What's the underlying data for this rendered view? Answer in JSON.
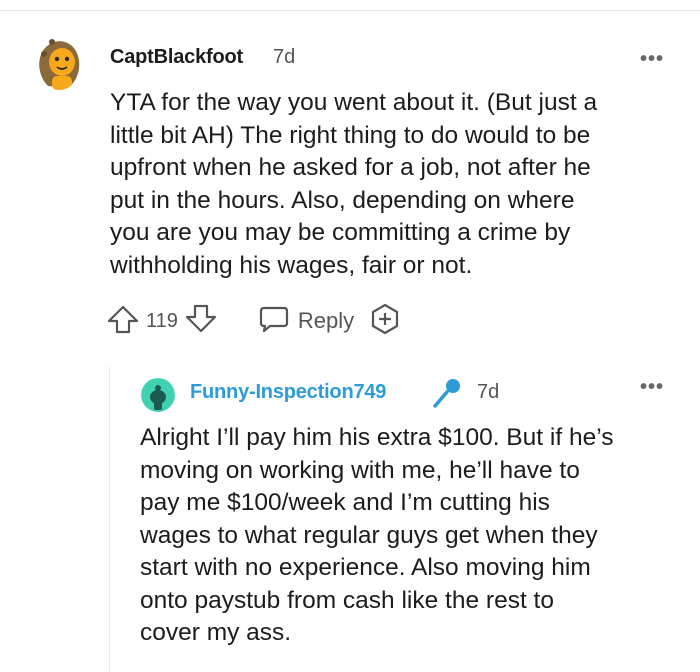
{
  "comment": {
    "author": "CaptBlackfoot",
    "age": "7d",
    "more_label": "•••",
    "body_lines": [
      "YTA for the way you went about it. (But just a",
      "little bit AH) The right thing to do would to be",
      "upfront when he asked for a job, not after he",
      "put in the hours. Also, depending on where",
      "you are you may be committing a crime by",
      "withholding his wages, fair or not."
    ],
    "vote_count": "119",
    "reply_label": "Reply"
  },
  "reply": {
    "author": "Funny-Inspection749",
    "age": "7d",
    "more_label": "•••",
    "body_lines": [
      "Alright I’ll pay him his extra $100. But if he’s",
      "moving on working with me, he’ll have to",
      "pay me $100/week and I’m cutting his",
      "wages to what regular guys get when they",
      "start with no experience. Also moving him",
      "onto paystub from cash like the rest to",
      "cover my ass."
    ]
  },
  "icons": {
    "upvote": "upvote-arrow-icon",
    "downvote": "downvote-arrow-icon",
    "reply": "speech-bubble-icon",
    "award": "award-plus-icon",
    "mic": "microphone-icon"
  },
  "colors": {
    "reply_author": "#2d9bd7",
    "text": "#1c1c1c",
    "muted": "#555555"
  }
}
